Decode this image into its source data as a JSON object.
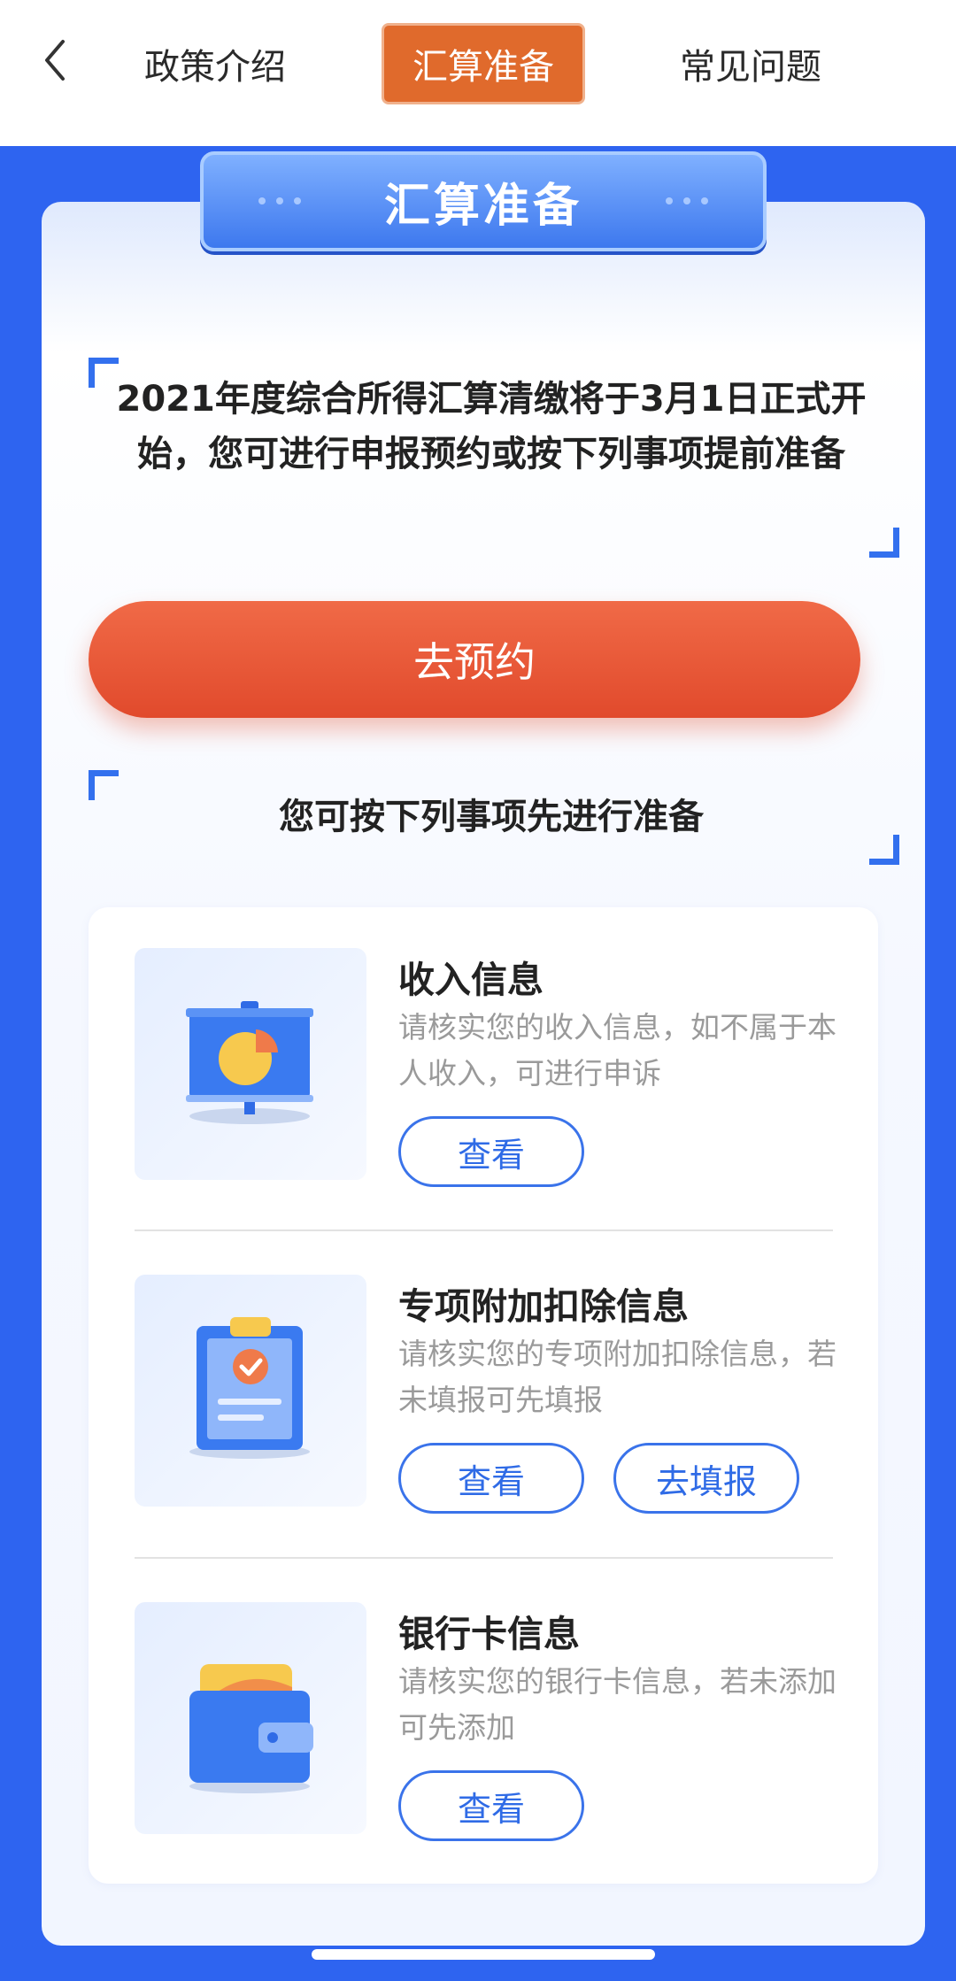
{
  "nav": {
    "tabs": [
      "政策介绍",
      "汇算准备",
      "常见问题"
    ],
    "active_tab": "汇算准备"
  },
  "banner": {
    "title": "汇算准备"
  },
  "intro": "2021年度综合所得汇算清缴将于3月1日正式开始，您可进行申报预约或按下列事项提前准备",
  "cta_label": "去预约",
  "subheading": "您可按下列事项先进行准备",
  "items": [
    {
      "title": "收入信息",
      "desc": "请核实您的收入信息，如不属于本人收入，可进行申诉",
      "buttons": [
        "查看"
      ],
      "icon": "presentation-chart-icon"
    },
    {
      "title": "专项附加扣除信息",
      "desc": "请核实您的专项附加扣除信息，若未填报可先填报",
      "buttons": [
        "查看",
        "去填报"
      ],
      "icon": "clipboard-check-icon"
    },
    {
      "title": "银行卡信息",
      "desc": "请核实您的银行卡信息，若未添加可先添加",
      "buttons": [
        "查看"
      ],
      "icon": "wallet-icon"
    }
  ],
  "colors": {
    "brand_blue": "#2e64f0",
    "accent_orange": "#e06a2c",
    "cta_red": "#e14a2c"
  }
}
